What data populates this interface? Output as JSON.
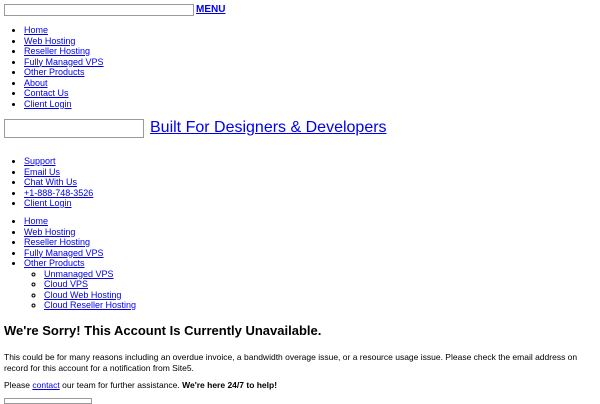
{
  "top_bar": {
    "search_value": "",
    "menu_label": "MENU"
  },
  "nav_primary": [
    "Home",
    "Web Hosting",
    "Reseller Hosting",
    "Fully Managed VPS",
    "Other Products",
    "About",
    "Contact Us",
    "Client Login"
  ],
  "header": {
    "tagline": "Built For Designers & Developers"
  },
  "nav_support": [
    "Support",
    "Email Us",
    "Chat With Us",
    "+1-888-748-3526",
    "Client Login"
  ],
  "nav_products": {
    "items": [
      "Home",
      "Web Hosting",
      "Reseller Hosting",
      "Fully Managed VPS",
      "Other Products"
    ],
    "other_products_sub": [
      "Unmanaged VPS",
      "Cloud VPS",
      "Cloud Web Hosting",
      "Cloud Reseller Hosting"
    ]
  },
  "main": {
    "heading": "We're Sorry! This Account Is Currently Unavailable.",
    "paragraph": "This could be for many reasons including an overdue invoice, a bandwidth overage issue, or a resource usage issue. Please check the email address on record for this account for a notification from Site5.",
    "help_prefix": "Please ",
    "help_link": "contact",
    "help_middle": " our team for further assistance. ",
    "help_bold": "We're here 24/7 to help!"
  }
}
